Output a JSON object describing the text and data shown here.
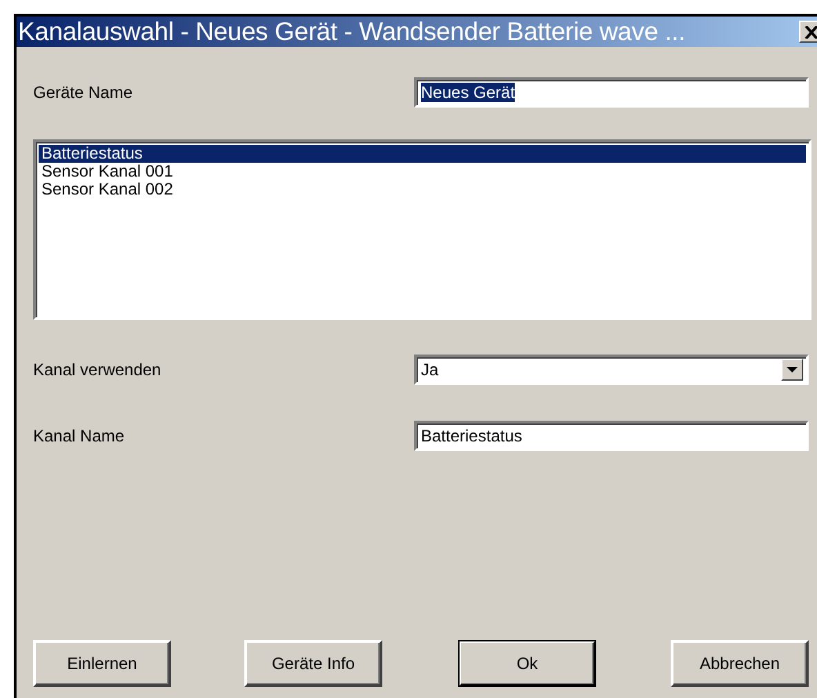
{
  "window": {
    "title": "Kanalauswahl - Neues Gerät - Wandsender Batterie wave ..."
  },
  "device_name": {
    "label": "Geräte Name",
    "value": "Neues Gerät",
    "text_selected": true
  },
  "channels": [
    {
      "label": "Batteriestatus",
      "selected": true
    },
    {
      "label": "Sensor Kanal 001",
      "selected": false
    },
    {
      "label": "Sensor Kanal 002",
      "selected": false
    }
  ],
  "use_channel": {
    "label": "Kanal verwenden",
    "value": "Ja"
  },
  "channel_name": {
    "label": "Kanal Name",
    "value": "Batteriestatus"
  },
  "buttons": [
    {
      "label": "Einlernen",
      "default": false
    },
    {
      "label": "Geräte Info",
      "default": false
    },
    {
      "label": "Ok",
      "default": true
    },
    {
      "label": "Abbrechen",
      "default": false
    }
  ]
}
